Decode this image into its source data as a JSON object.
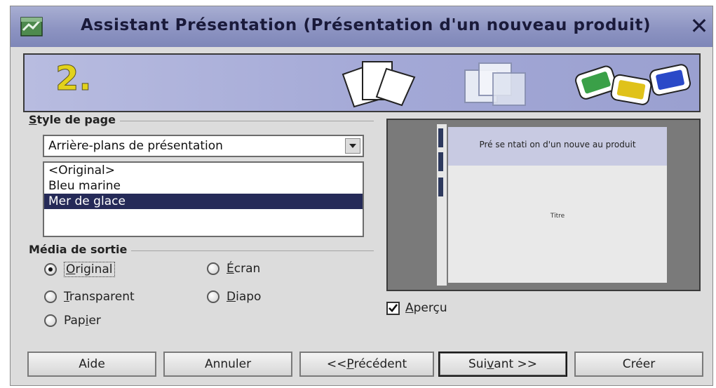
{
  "window": {
    "title": "Assistant Présentation (Présentation d'un nouveau produit)",
    "close_glyph": "✕"
  },
  "banner": {
    "step_number": "2.",
    "icons": [
      "pages-icon",
      "overlapping-squares-icon",
      "slides-icon"
    ]
  },
  "page_style": {
    "group_label_accel": "S",
    "group_label_rest": "tyle de page",
    "dropdown_value": "Arrière-plans de présentation",
    "items": [
      "<Original>",
      "Bleu marine",
      "Mer de glace"
    ],
    "selected_index": 2
  },
  "output_media": {
    "group_label": "Média de sortie",
    "options": [
      {
        "pre": "",
        "accel": "O",
        "post": "riginal",
        "selected": true
      },
      {
        "pre": "",
        "accel": "É",
        "post": "cran",
        "selected": false
      },
      {
        "pre": "",
        "accel": "T",
        "post": "ransparent",
        "selected": false
      },
      {
        "pre": "",
        "accel": "D",
        "post": "iapo",
        "selected": false
      },
      {
        "pre": "Pap",
        "accel": "i",
        "post": "er",
        "selected": false
      }
    ]
  },
  "preview": {
    "slide_title": "Pré se ntati on d'un nouve au produit",
    "slide_subtitle": "Titre",
    "checkbox_accel": "A",
    "checkbox_rest": "perçu",
    "checked": true
  },
  "buttons": {
    "help": "Aide",
    "cancel": "Annuler",
    "back_pre": "<< ",
    "back_accel": "P",
    "back_post": "récédent",
    "next_pre": "Sui",
    "next_accel": "v",
    "next_post": "ant >>",
    "create": "Créer"
  },
  "colors": {
    "titlebar": "#8d94c2",
    "banner": "#a3a8d6",
    "selection": "#252a58",
    "step_number": "#e2d21c"
  }
}
